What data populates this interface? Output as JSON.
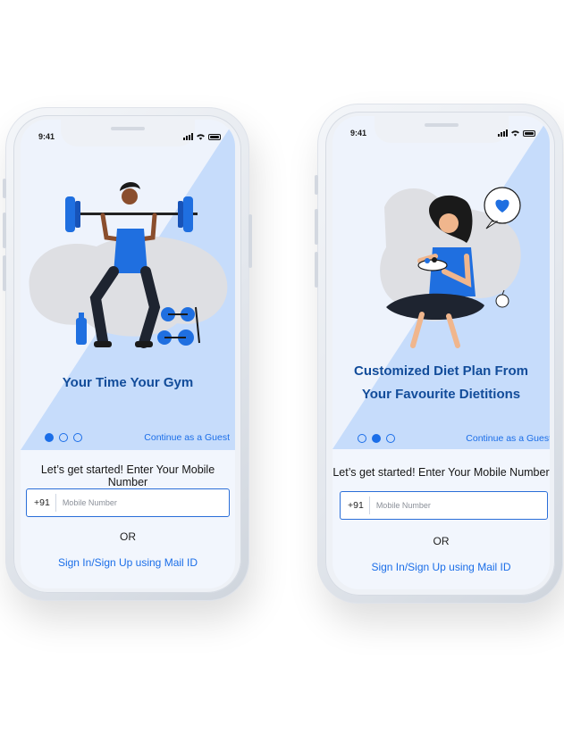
{
  "screens": [
    {
      "status_time": "9:41",
      "hero_title_lines": [
        "Your Time Your Gym"
      ],
      "pagination_active": 0,
      "pagination_count": 3,
      "guest_link": "Continue as a Guest",
      "prompt": "Let’s get started! Enter Your Mobile Number",
      "country_code": "+91",
      "mobile_placeholder": "Mobile Number",
      "or_label": "OR",
      "mail_link": "Sign In/Sign Up using Mail ID",
      "illustration": "weightlifter-illustration"
    },
    {
      "status_time": "9:41",
      "hero_title_lines": [
        "Customized Diet Plan From",
        "Your Favourite Dietitions"
      ],
      "pagination_active": 1,
      "pagination_count": 3,
      "guest_link": "Continue as a Guest",
      "prompt": "Let’s get started! Enter Your Mobile Number",
      "country_code": "+91",
      "mobile_placeholder": "Mobile Number",
      "or_label": "OR",
      "mail_link": "Sign In/Sign Up using Mail ID",
      "illustration": "woman-eating-salad-illustration"
    }
  ],
  "colors": {
    "accent": "#1b6ee8",
    "hero_title": "#124c9a",
    "hero_triangle": "#c6dcfb",
    "hero_light": "#eef3fc"
  }
}
